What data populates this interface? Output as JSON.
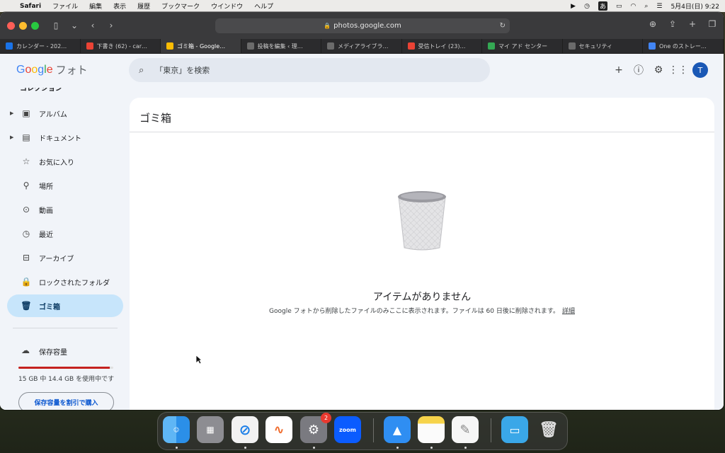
{
  "menubar": {
    "app": "Safari",
    "items": [
      "ファイル",
      "編集",
      "表示",
      "履歴",
      "ブックマーク",
      "ウインドウ",
      "ヘルプ"
    ],
    "ime": "あ",
    "datetime": "5月4日(日)  9:22"
  },
  "browser": {
    "url": "photos.google.com",
    "tabs": [
      {
        "title": "カレンダー - 202…",
        "color": "#1a73e8"
      },
      {
        "title": "下書き (62) - car…",
        "color": "#ea4335"
      },
      {
        "title": "ゴミ箱 - Google…",
        "color": "#fbbc04"
      },
      {
        "title": "投稿を編集 ‹ 理…",
        "color": "#6b6b6b"
      },
      {
        "title": "メディアライブラ…",
        "color": "#6b6b6b"
      },
      {
        "title": "受信トレイ (23)…",
        "color": "#ea4335"
      },
      {
        "title": "マイ アド センター",
        "color": "#34a853"
      },
      {
        "title": "セキュリティ",
        "color": "#6b6b6b"
      },
      {
        "title": "One のストレー…",
        "color": "#4285f4"
      }
    ]
  },
  "header": {
    "logo_google": "Google",
    "logo_product": "フォト",
    "search_placeholder": "「東京」を検索",
    "avatar_letter": "T"
  },
  "sidebar": {
    "section": "コレクション",
    "items": [
      {
        "label": "アルバム",
        "icon": "album-icon"
      },
      {
        "label": "ドキュメント",
        "icon": "document-icon"
      },
      {
        "label": "お気に入り",
        "icon": "star-icon"
      },
      {
        "label": "場所",
        "icon": "location-icon"
      },
      {
        "label": "動画",
        "icon": "video-icon"
      },
      {
        "label": "最近",
        "icon": "clock-icon"
      },
      {
        "label": "アーカイブ",
        "icon": "archive-icon"
      },
      {
        "label": "ロックされたフォルダ",
        "icon": "lock-icon"
      },
      {
        "label": "ゴミ箱",
        "icon": "trash-icon"
      }
    ],
    "storage_label": "保存容量",
    "storage_used_fraction": 0.96,
    "storage_text": "15 GB 中 14.4 GB を使用中です",
    "buy_button": "保存容量を割引で購入"
  },
  "main": {
    "title": "ゴミ箱",
    "empty_title": "アイテムがありません",
    "empty_sub": "Google フォトから削除したファイルのみここに表示されます。ファイルは 60 日後に削除されます。",
    "details_link": "詳細"
  },
  "dock": {
    "zoom_label": "zoom",
    "settings_badge": "2"
  },
  "colors": {
    "accent": "#0b57d0",
    "active_nav": "#c7e5fb",
    "storage_warn": "#c5221f"
  }
}
